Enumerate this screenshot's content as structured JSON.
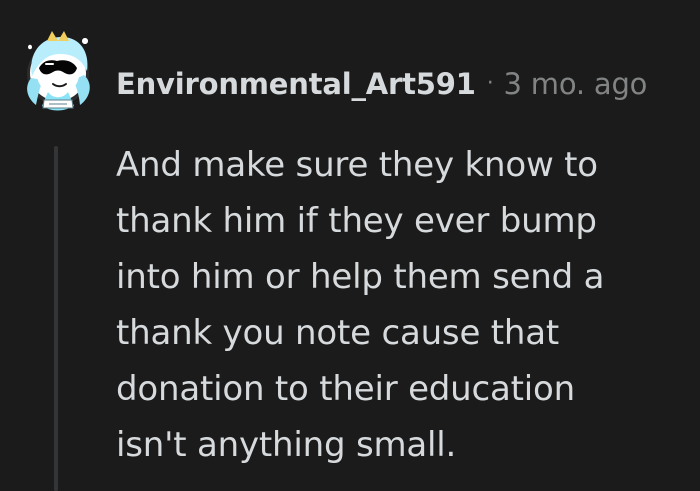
{
  "comment": {
    "username": "Environmental_Art591",
    "separator": "·",
    "timestamp": "3 mo. ago",
    "avatar_icon": "avatar-icon",
    "body_lines": [
      "And make sure they know to",
      "thank him if they ever bump",
      "into him or help them send a",
      "thank you note cause that",
      "donation to their education",
      "isn't anything small."
    ]
  },
  "colors": {
    "background": "#1b1b1b",
    "text": "#d7dadc",
    "muted": "#818384",
    "thread_line": "#343536"
  }
}
